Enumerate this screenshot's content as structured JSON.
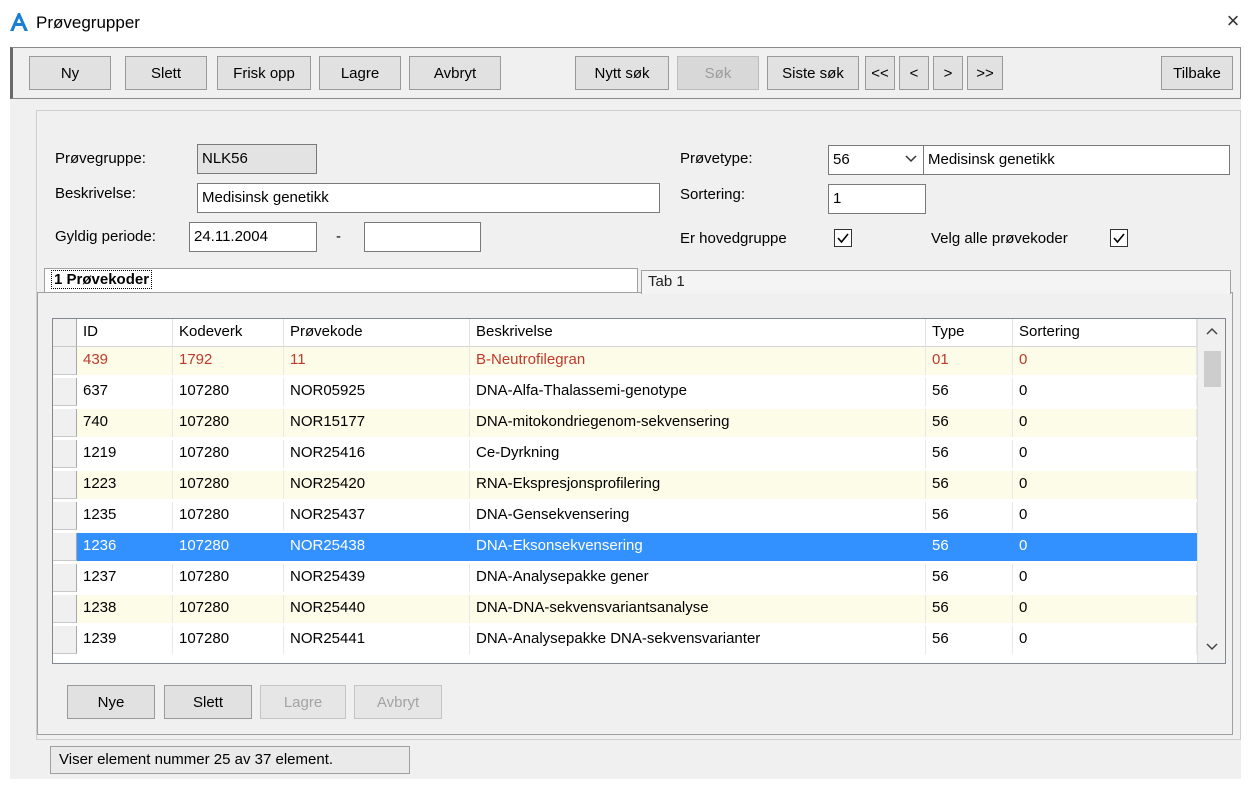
{
  "window": {
    "title": "Prøvegrupper",
    "close_glyph": "×",
    "icon": "app-a-icon"
  },
  "toolbar": {
    "new": "Ny",
    "delete": "Slett",
    "refresh": "Frisk opp",
    "save": "Lagre",
    "cancel": "Avbryt",
    "new_search": "Nytt søk",
    "search": "Søk",
    "last_search": "Siste søk",
    "first": "<<",
    "prev": "<",
    "next": ">",
    "last": ">>",
    "back": "Tilbake"
  },
  "form": {
    "provegruppe_label": "Prøvegruppe:",
    "provegruppe_value": "NLK56",
    "beskrivelse_label": "Beskrivelse:",
    "beskrivelse_value": "Medisinsk genetikk",
    "gyldig_label": "Gyldig periode:",
    "gyldig_from": "24.11.2004",
    "gyldig_sep": "-",
    "gyldig_to": "",
    "provetype_label": "Prøvetype:",
    "provetype_code": "56",
    "provetype_desc": "Medisinsk genetikk",
    "sortering_label": "Sortering:",
    "sortering_value": "1",
    "hovedgruppe_label": "Er hovedgruppe",
    "hovedgruppe_checked": true,
    "velg_alle_label": "Velg alle prøvekoder",
    "velg_alle_checked": true
  },
  "tabs": {
    "active": "1 Prøvekoder",
    "other": "Tab 1"
  },
  "grid": {
    "headers": [
      "ID",
      "Kodeverk",
      "Prøvekode",
      "Beskrivelse",
      "Type",
      "Sortering"
    ],
    "rows": [
      [
        "439",
        "1792",
        "11",
        "B-Neutrofilegran",
        "01",
        "0"
      ],
      [
        "637",
        "107280",
        "NOR05925",
        "DNA-Alfa-Thalassemi-genotype",
        "56",
        "0"
      ],
      [
        "740",
        "107280",
        "NOR15177",
        "DNA-mitokondriegenom-sekvensering",
        "56",
        "0"
      ],
      [
        "1219",
        "107280",
        "NOR25416",
        "Ce-Dyrkning",
        "56",
        "0"
      ],
      [
        "1223",
        "107280",
        "NOR25420",
        "RNA-Ekspresjonsprofilering",
        "56",
        "0"
      ],
      [
        "1235",
        "107280",
        "NOR25437",
        "DNA-Gensekvensering",
        "56",
        "0"
      ],
      [
        "1236",
        "107280",
        "NOR25438",
        "DNA-Eksonsekvensering",
        "56",
        "0"
      ],
      [
        "1237",
        "107280",
        "NOR25439",
        "DNA-Analysepakke gener",
        "56",
        "0"
      ],
      [
        "1238",
        "107280",
        "NOR25440",
        "DNA-DNA-sekvensvariantsanalyse",
        "56",
        "0"
      ],
      [
        "1239",
        "107280",
        "NOR25441",
        "DNA-Analysepakke DNA-sekvensvarianter",
        "56",
        "0"
      ]
    ],
    "selected_row": 6,
    "highlight_row": 0
  },
  "bottom_buttons": {
    "new": "Nye",
    "delete": "Slett",
    "save": "Lagre",
    "cancel": "Avbryt"
  },
  "status": "Viser element nummer 25 av 37 element.",
  "colors": {
    "selection": "#3390ff",
    "alt_row": "#fcfce8",
    "red_text": "#c0392b"
  }
}
